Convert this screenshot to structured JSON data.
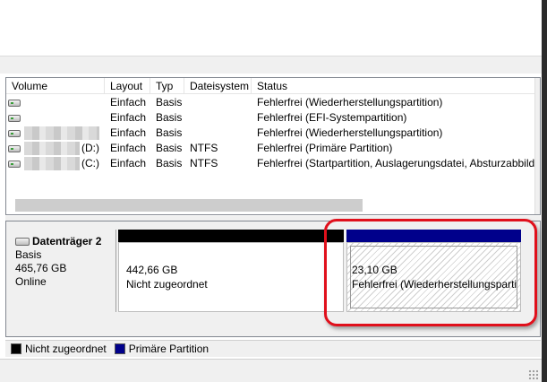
{
  "table": {
    "headers": [
      "Volume",
      "Layout",
      "Typ",
      "Dateisystem",
      "Status"
    ],
    "rows": [
      {
        "volume": "",
        "layout": "Einfach",
        "type": "Basis",
        "fs": "",
        "status": "Fehlerfrei (Wiederherstellungspartition)"
      },
      {
        "volume": "",
        "layout": "Einfach",
        "type": "Basis",
        "fs": "",
        "status": "Fehlerfrei (EFI-Systempartition)"
      },
      {
        "volume": "",
        "layout": "Einfach",
        "type": "Basis",
        "fs": "",
        "status": "Fehlerfrei (Wiederherstellungspartition)"
      },
      {
        "volume": "(D:)",
        "layout": "Einfach",
        "type": "Basis",
        "fs": "NTFS",
        "status": "Fehlerfrei (Primäre Partition)"
      },
      {
        "volume": "(C:)",
        "layout": "Einfach",
        "type": "Basis",
        "fs": "NTFS",
        "status": "Fehlerfrei (Startpartition, Auslagerungsdatei, Absturzabbild,"
      }
    ]
  },
  "disk": {
    "name": "Datenträger 2",
    "type": "Basis",
    "size": "465,76 GB",
    "state": "Online"
  },
  "partitions": {
    "unallocated": {
      "size": "442,66 GB",
      "label": "Nicht zugeordnet"
    },
    "recovery": {
      "size": "23,10 GB",
      "label": "Fehlerfrei (Wiederherstellungsparti"
    }
  },
  "legend": {
    "unallocated": "Nicht zugeordnet",
    "primary": "Primäre Partition"
  },
  "colors": {
    "unallocated": "#000000",
    "primary": "#00008b",
    "highlight": "#e0101c"
  }
}
